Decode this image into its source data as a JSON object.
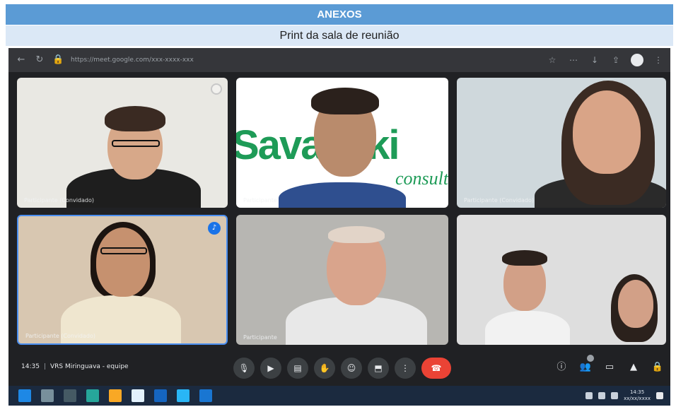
{
  "document": {
    "title": "ANEXOS",
    "subtitle": "Print da sala de reunião"
  },
  "browser": {
    "url": "https://meet.google.com/xxx-xxxx-xxx",
    "icons": [
      "back-icon",
      "reload-icon",
      "lock-icon",
      "star-icon",
      "extensions-icon",
      "profile-icon",
      "menu-icon"
    ]
  },
  "tiles": [
    {
      "name": "Participante (Convidado)",
      "bg": "#e9e8e3",
      "shirt": "#1e1e1e",
      "skin": "#d7a889",
      "hair": "#3a2a22",
      "glasses": true
    },
    {
      "name": "Participante",
      "bg": "#ffffff",
      "shirt": "#2f4f8f",
      "skin": "#b98b6c",
      "hair": "#2b211c",
      "glasses": false,
      "brand_text": "Savanski",
      "brand_sub": "consult"
    },
    {
      "name": "Participante (Convidado)",
      "bg": "#cfd8dc",
      "shirt": "#2a2a2a",
      "skin": "#d9a487",
      "hair": "#3b2b23",
      "glasses": false
    },
    {
      "name": "Participante (Convidado)",
      "bg": "#d8c7b1",
      "shirt": "#efe6cf",
      "skin": "#c6916f",
      "hair": "#1c1410",
      "glasses": true
    },
    {
      "name": "Participante",
      "bg": "#b7b6b2",
      "shirt": "#e8e8e8",
      "skin": "#d9a48c",
      "hair": "#e2d4c8",
      "glasses": false
    },
    {
      "name": "",
      "bg": "#dedede",
      "shirt": "#f2f2f2",
      "skin": "#d2a087",
      "hair": "#2b211c",
      "glasses": false
    }
  ],
  "meeting": {
    "time": "14:35",
    "separator": "|",
    "title": "VRS Miringuava - equipe"
  },
  "controls": [
    "mic-icon",
    "camera-icon",
    "captions-icon",
    "raise-hand-icon",
    "emoji-icon",
    "present-icon",
    "more-icon",
    "end-call-icon"
  ],
  "right_controls": [
    "info-icon",
    "people-icon",
    "chat-icon",
    "activities-icon",
    "lock-icon"
  ],
  "taskbar": {
    "icons": [
      "#1e88e5",
      "#78909c",
      "#455a64",
      "#26a69a",
      "#f9a825",
      "#e3f2fd",
      "#1565c0",
      "#29b6f6",
      "#1976d2"
    ],
    "tray_time": "14:35",
    "tray_date": "xx/xx/xxxx"
  }
}
